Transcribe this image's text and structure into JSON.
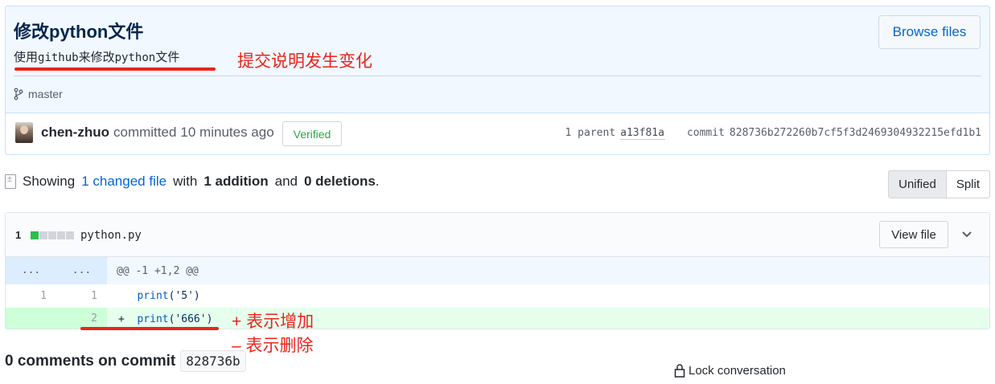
{
  "commit": {
    "title": "修改python文件",
    "description_prefix": "使用",
    "description_mono1": "github",
    "description_mid": "来修改",
    "description_mono2": "python",
    "description_suffix": "文件",
    "browse_label": "Browse files",
    "branch": "master",
    "author": "chen-zhuo",
    "committed_text": "committed",
    "time_ago": "10 minutes ago",
    "verified_label": "Verified",
    "parent_label": "1 parent",
    "parent_sha": "a13f81a",
    "commit_label": "commit",
    "commit_sha": "828736b272260b7cf5f3d2469304932215efd1b1"
  },
  "annotations": {
    "commit_note": "提交说明发生变化",
    "plus_note": "+ 表示增加",
    "minus_note": "– 表示删除"
  },
  "toc": {
    "showing": "Showing",
    "changed_link": "1 changed file",
    "with": "with",
    "additions": "1 addition",
    "and": "and",
    "deletions": "0 deletions",
    "period": "."
  },
  "view_toggle": {
    "unified": "Unified",
    "split": "Split"
  },
  "diff": {
    "count": "1",
    "file_name": "python.py",
    "view_file": "View file",
    "hunk_left": "...",
    "hunk_right": "...",
    "hunk_header": "@@ -1 +1,2 @@",
    "lines": [
      {
        "old": "1",
        "new": "1",
        "marker": " ",
        "fn": "print",
        "arg": "('5')"
      },
      {
        "old": "",
        "new": "2",
        "marker": "+",
        "fn": "print",
        "arg": "('666')"
      }
    ]
  },
  "comments": {
    "title": "0 comments on commit",
    "sha": "828736b",
    "lock_label": "Lock conversation"
  },
  "colors": {
    "accent": "#0366d6",
    "annotation": "#e8251d",
    "addition": "#2cbe4e"
  }
}
